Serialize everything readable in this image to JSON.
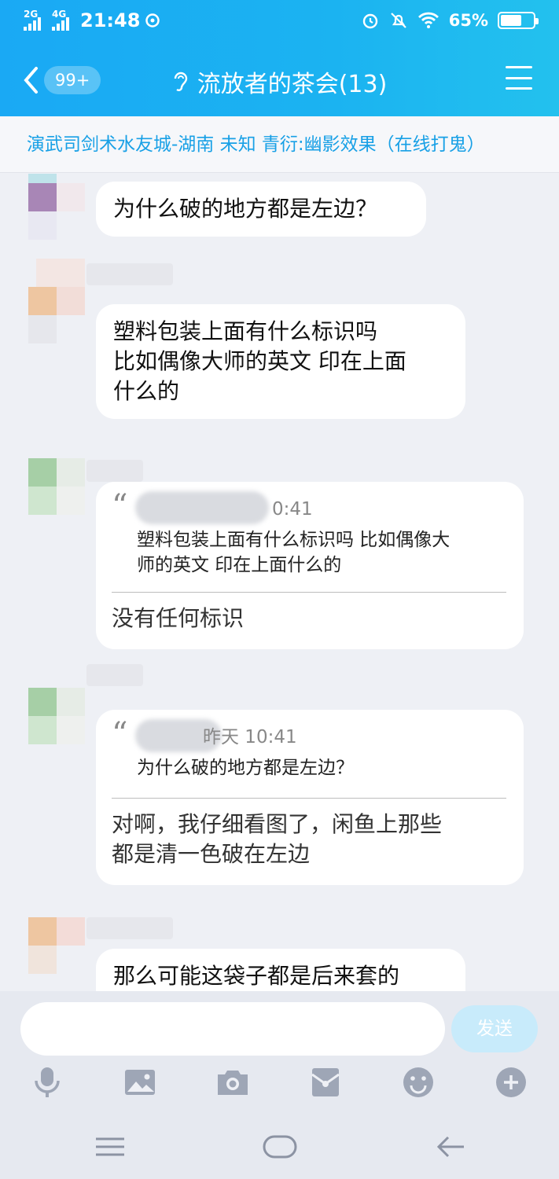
{
  "status_bar": {
    "net1": "2G",
    "net2": "4G",
    "time": "21:48",
    "battery": "65%",
    "battery_level": 0.65
  },
  "header": {
    "unread_badge": "99+",
    "title": "流放者的茶会(13)"
  },
  "notice": "演武司剑术水友城-湖南 未知 青衍:幽影效果（在线打鬼）",
  "messages": [
    {
      "text": "为什么破的地方都是左边？"
    },
    {
      "text_line1": "塑料包装上面有什么标识吗",
      "text_line2": "比如偶像大师的英文  印在上面",
      "text_line3": "什么的"
    },
    {
      "quote_time": "0:41",
      "quote_line1": "塑料包装上面有什么标识吗   比如偶像大",
      "quote_line2": "师的英文  印在上面什么的",
      "text": "没有任何标识"
    },
    {
      "quote_time": "昨天 10:41",
      "quote_line1": "为什么破的地方都是左边？",
      "text_line1": "对啊，我仔细看图了，闲鱼上那些",
      "text_line2": "都是清一色破在左边"
    },
    {
      "text": "那么可能这袋子都是后来套的"
    }
  ],
  "input": {
    "send_label": "发送"
  },
  "toolbar_icons": [
    "microphone-icon",
    "image-icon",
    "camera-icon",
    "red-packet-icon",
    "emoji-icon",
    "plus-icon"
  ],
  "colors": {
    "header": "#1aa9f4",
    "notice_text": "#18a0e6",
    "send_button": "#c8ebfb",
    "background": "#eef0f5"
  }
}
